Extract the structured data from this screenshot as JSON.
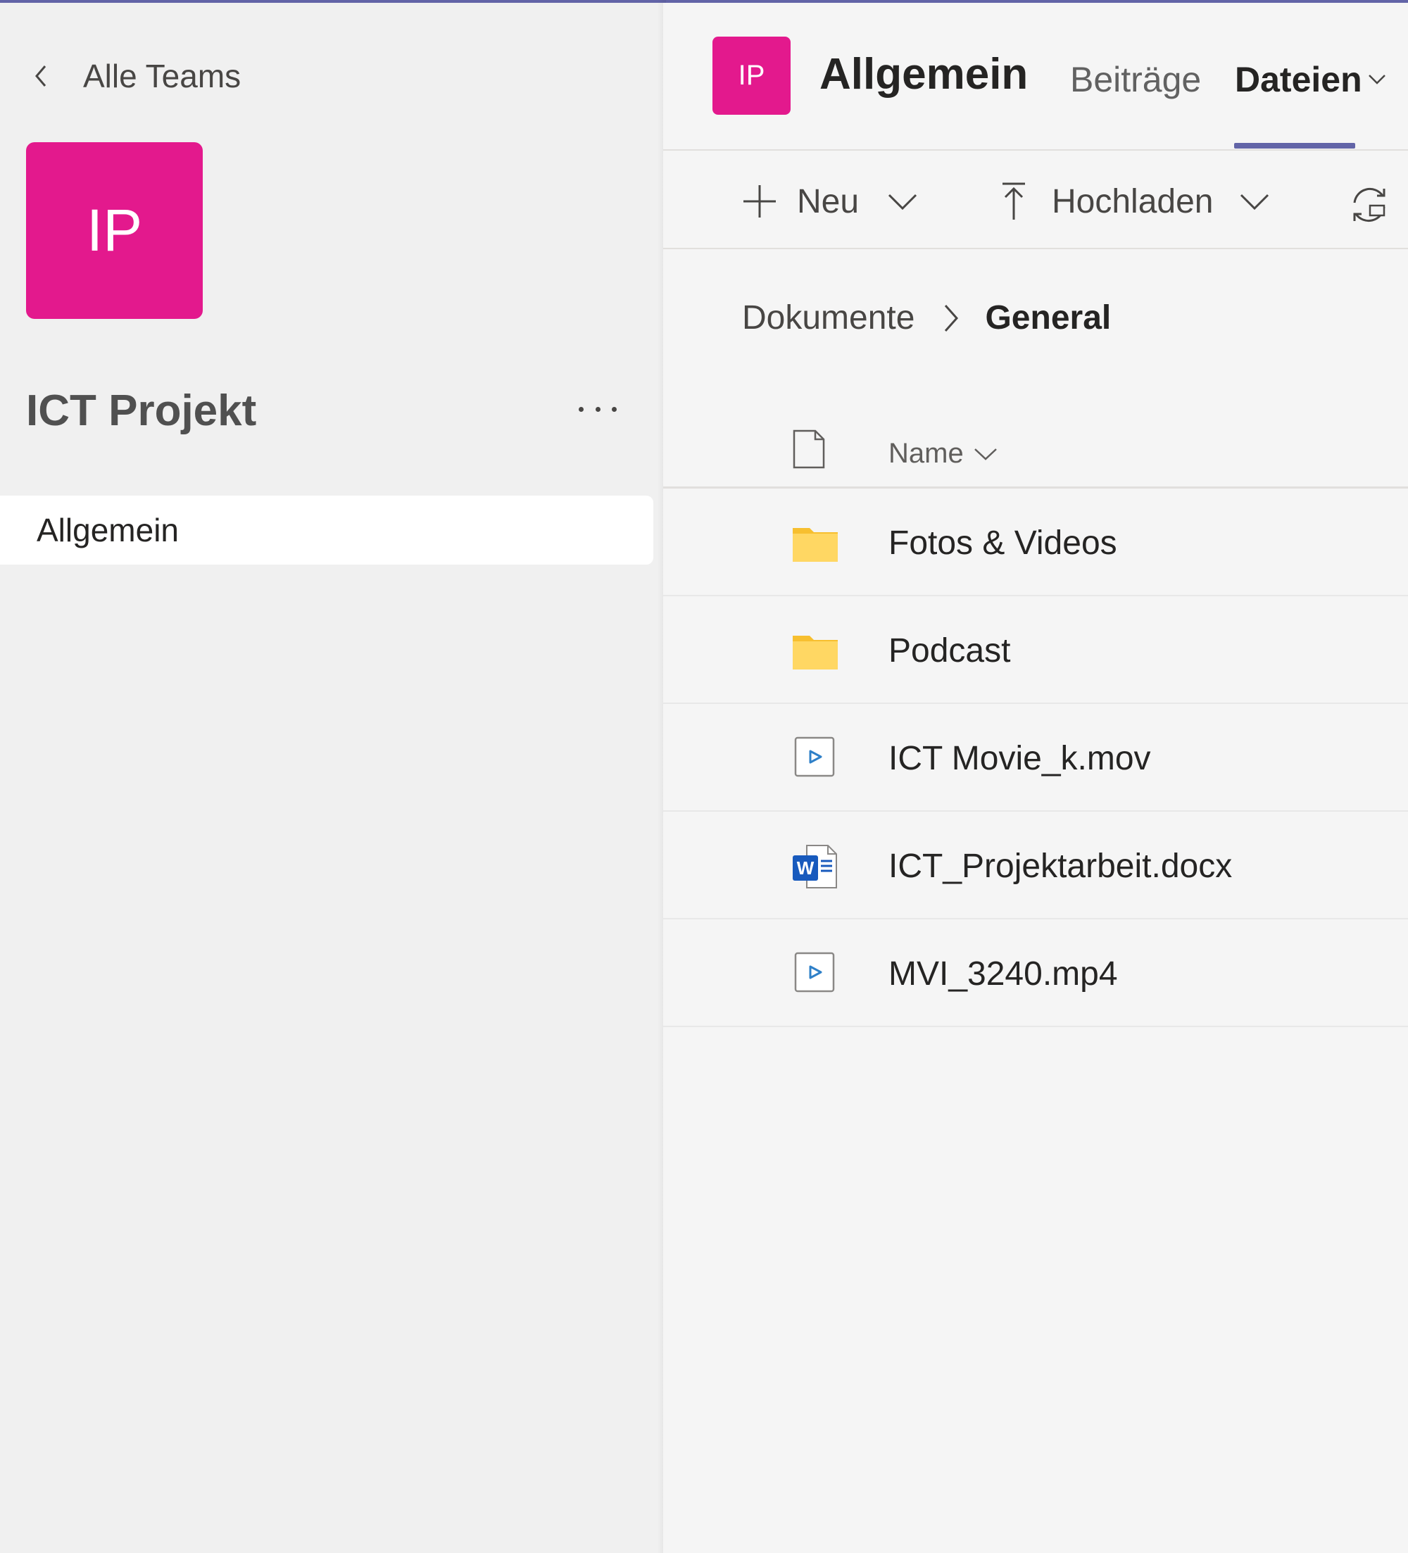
{
  "sidebar": {
    "back_label": "Alle Teams",
    "team_avatar_initials": "IP",
    "team_name": "ICT Projekt",
    "channels": [
      {
        "label": "Allgemein",
        "selected": true
      }
    ]
  },
  "channel": {
    "avatar_initials": "IP",
    "title": "Allgemein",
    "tabs": [
      {
        "label": "Beiträge",
        "active": false
      },
      {
        "label": "Dateien",
        "active": true
      }
    ]
  },
  "toolbar": {
    "new_label": "Neu",
    "upload_label": "Hochladen"
  },
  "breadcrumb": {
    "root": "Dokumente",
    "current": "General"
  },
  "files": {
    "column_name": "Name",
    "items": [
      {
        "name": "Fotos & Videos",
        "type": "folder"
      },
      {
        "name": "Podcast",
        "type": "folder"
      },
      {
        "name": "ICT Movie_k.mov",
        "type": "video"
      },
      {
        "name": "ICT_Projektarbeit.docx",
        "type": "word"
      },
      {
        "name": "MVI_3240.mp4",
        "type": "video"
      }
    ]
  },
  "colors": {
    "accent": "#6264a7",
    "avatar": "#e3198d",
    "folder": "#ffce3d",
    "word_blue": "#185abd"
  }
}
